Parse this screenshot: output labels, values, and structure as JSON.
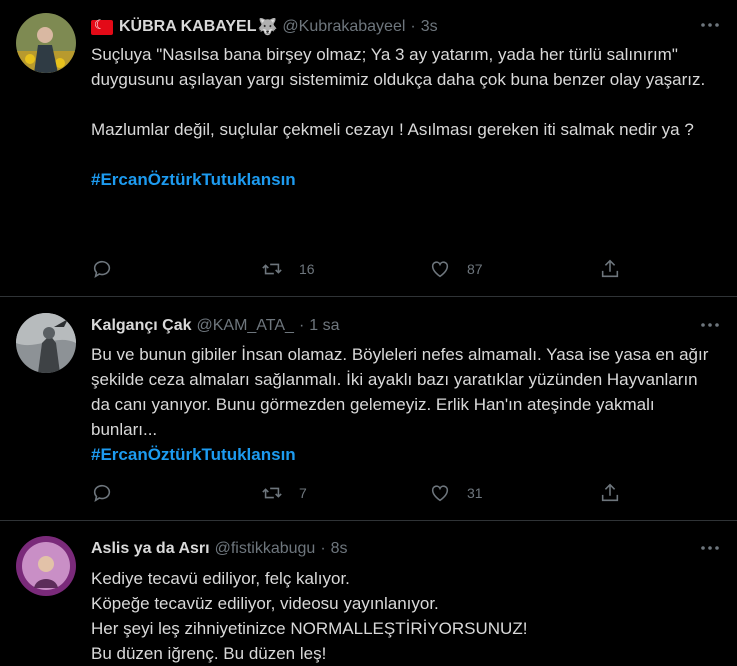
{
  "tweets": [
    {
      "name": "KÜBRA KABAYEL",
      "name_emoji": "🐺",
      "handle": "@Kubrakabayeel",
      "time": "3s",
      "paragraphs": [
        "Suçluya \"Nasılsa bana birşey olmaz; Ya 3 ay yatarım, yada her türlü salınırım\" duygusunu aşılayan yargı sistemimiz oldukça daha çok buna benzer olay yaşarız.",
        "Mazlumlar değil, suçlular çekmeli cezayı ! Asılması gereken iti salmak nedir ya ?"
      ],
      "hashtag": "#ErcanÖztürkTutuklansın",
      "retweets": "16",
      "likes": "87"
    },
    {
      "name": "Kalgançı Çak",
      "handle": "@KAM_ATA_",
      "time": "1 sa",
      "text": "Bu ve bunun gibiler İnsan olamaz. Böyleleri nefes almamalı. Yasa ise yasa en ağır şekilde ceza almaları sağlanmalı. İki ayaklı bazı yaratıklar yüzünden Hayvanların da canı yanıyor. Bunu görmezden gelemeyiz. Erlik Han'ın ateşinde yakmalı bunları...",
      "hashtag": "#ErcanÖztürkTutuklansın",
      "retweets": "7",
      "likes": "31"
    },
    {
      "name": "Aslis ya da Asrı",
      "handle": "@fistikkabugu",
      "time": "8s",
      "lines": [
        "Kediye tecavü ediliyor, felç kalıyor.",
        "Köpeğe tecavüz ediliyor, videosu yayınlanıyor.",
        "Her şeyi leş zihniyetinizce NORMALLEŞTİRİYORSUNUZ!",
        "Bu düzen iğrenç. Bu düzen leş!"
      ]
    }
  ],
  "separator": "·",
  "colors": {
    "background": "#000000",
    "text": "#d9d9d9",
    "muted": "#6e767d",
    "link": "#1d9bf0",
    "divider": "#2f3336"
  }
}
